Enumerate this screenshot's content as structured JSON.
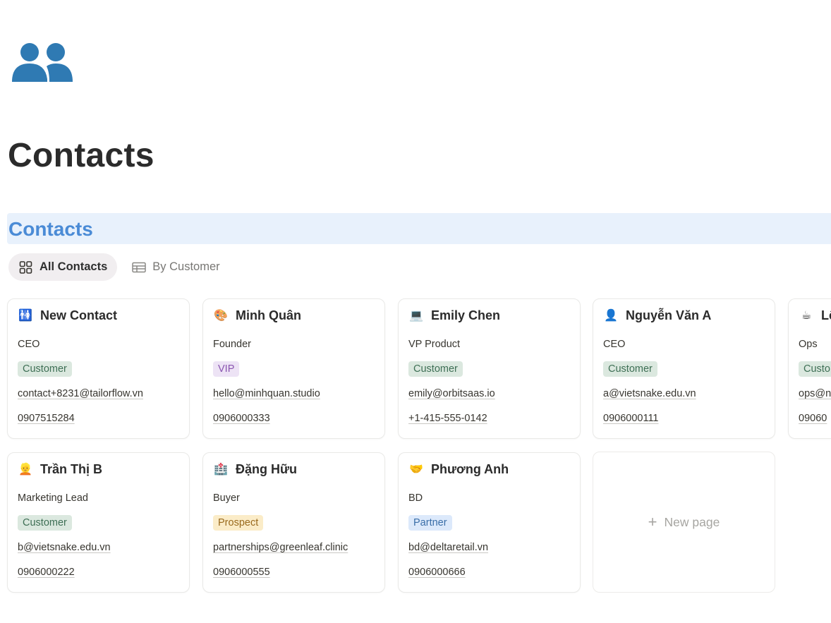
{
  "page": {
    "title": "Contacts",
    "icon": "people-icon"
  },
  "database": {
    "title": "Contacts",
    "views": [
      {
        "label": "All Contacts",
        "icon": "gallery-icon",
        "active": true
      },
      {
        "label": "By Customer",
        "icon": "table-icon",
        "active": false
      }
    ]
  },
  "cards": [
    {
      "emoji": "🚻",
      "name": "New Contact",
      "role": "CEO",
      "tag": "Customer",
      "email": "contact+8231@tailorflow.vn",
      "phone": "0907515284"
    },
    {
      "emoji": "🎨",
      "name": "Minh Quân",
      "role": "Founder",
      "tag": "VIP",
      "email": "hello@minhquan.studio",
      "phone": "0906000333"
    },
    {
      "emoji": "💻",
      "name": "Emily Chen",
      "role": "VP Product",
      "tag": "Customer",
      "email": "emily@orbitsaas.io",
      "phone": "+1-415-555-0142"
    },
    {
      "emoji": "👤",
      "name": "Nguyễn Văn A",
      "role": "CEO",
      "tag": "Customer",
      "email": "a@vietsnake.edu.vn",
      "phone": "0906000111"
    },
    {
      "emoji": "☕",
      "name": "Lê",
      "role": "Ops",
      "tag": "Custo",
      "email": "ops@n",
      "phone": "09060"
    },
    {
      "emoji": "👱",
      "name": "Trần Thị B",
      "role": "Marketing Lead",
      "tag": "Customer",
      "email": "b@vietsnake.edu.vn",
      "phone": "0906000222"
    },
    {
      "emoji": "🏥",
      "name": "Đặng Hữu",
      "role": "Buyer",
      "tag": "Prospect",
      "email": "partnerships@greenleaf.clinic",
      "phone": "0906000555"
    },
    {
      "emoji": "🤝",
      "name": "Phương Anh",
      "role": "BD",
      "tag": "Partner",
      "email": "bd@deltaretail.vn",
      "phone": "0906000666"
    }
  ],
  "new_page": {
    "label": "New page"
  },
  "colors": {
    "accent": "#4a8bd6",
    "header_bg": "#e8f1fc",
    "icon": "#2f7ab3",
    "tag_customer": "#dbe8df",
    "tag_vip": "#ede3f5",
    "tag_prospect": "#fbecc8",
    "tag_partner": "#dce9fb"
  }
}
